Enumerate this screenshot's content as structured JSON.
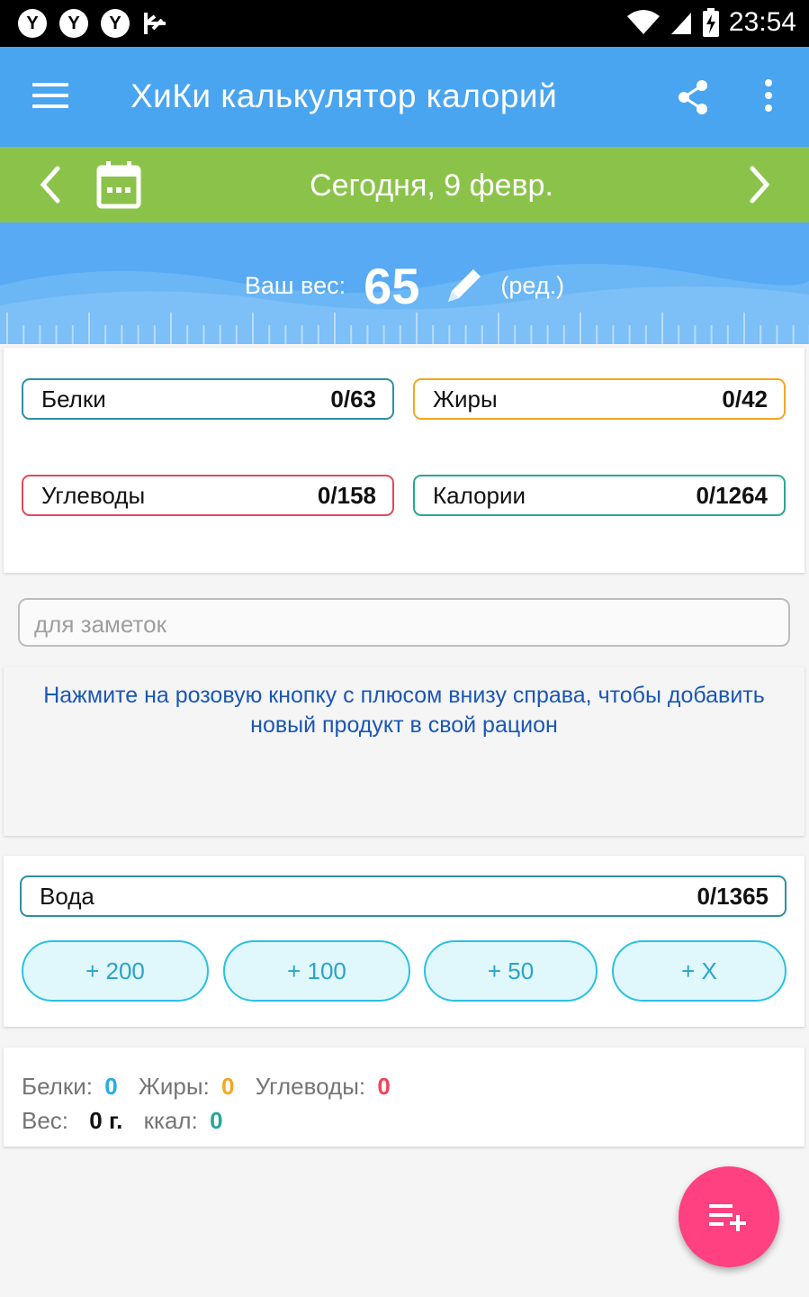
{
  "status_bar": {
    "notification_icons": [
      "Y",
      "Y",
      "Y"
    ],
    "time": "23:54"
  },
  "app_bar": {
    "title": "ХиКи калькулятор калорий"
  },
  "date_bar": {
    "date": "Сегодня, 9 февр."
  },
  "weight": {
    "label": "Ваш вес:",
    "value": "65",
    "edit_label": "(ред.)"
  },
  "macros": [
    {
      "name": "Белки",
      "value": "0/63",
      "color": "#2f8ea3"
    },
    {
      "name": "Жиры",
      "value": "0/42",
      "color": "#f5a623"
    },
    {
      "name": "Углеводы",
      "value": "0/158",
      "color": "#e0495a"
    },
    {
      "name": "Калории",
      "value": "0/1264",
      "color": "#26a69a"
    }
  ],
  "notes": {
    "placeholder": "для заметок"
  },
  "hint": {
    "text": "Нажмите на розовую кнопку с плюсом внизу справа, чтобы добавить новый продукт в свой рацион"
  },
  "water": {
    "label": "Вода",
    "value": "0/1365",
    "buttons": [
      "+ 200",
      "+ 100",
      "+ 50",
      "+ X"
    ]
  },
  "summary": {
    "protein_label": "Белки:",
    "protein_value": "0",
    "fat_label": "Жиры:",
    "fat_value": "0",
    "carbs_label": "Углеводы:",
    "carbs_value": "0",
    "weight_label": "Вес:",
    "weight_value": "0 г.",
    "kcal_label": "ккал:",
    "kcal_value": "0"
  },
  "colors": {
    "app_bar": "#4aa5f0",
    "date_bar": "#8bc34a",
    "fab": "#ff4081",
    "protein": "#29abe2",
    "fat": "#f5a623",
    "carbs": "#f0435a",
    "kcal": "#26a69a"
  },
  "icons": {
    "menu": "menu-icon",
    "share": "share-icon",
    "more": "more-vert-icon",
    "prev": "chevron-left-icon",
    "calendar": "calendar-icon",
    "next": "chevron-right-icon",
    "edit": "pencil-icon",
    "fab": "playlist-add-icon"
  }
}
